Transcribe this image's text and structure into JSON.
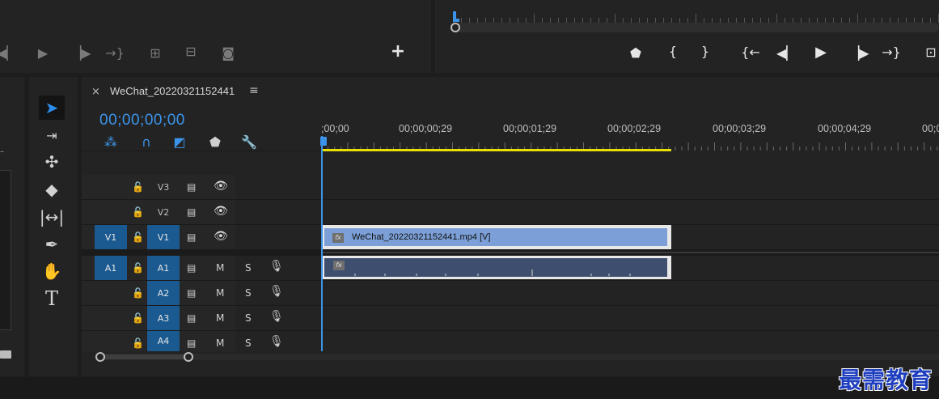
{
  "source_monitor": {
    "transport": [
      "step-back-icon",
      "play-icon",
      "step-forward-icon",
      "go-to-out-icon",
      "insert-icon",
      "overwrite-icon",
      "export-frame-icon",
      "add-button-icon"
    ],
    "plus_label": "+"
  },
  "program_monitor": {
    "transport": [
      "marker-icon",
      "mark-in-icon",
      "mark-out-icon",
      "go-to-in-icon",
      "step-back-icon",
      "play-icon",
      "step-forward-icon",
      "go-to-out-icon",
      "lift-icon"
    ]
  },
  "tools": [
    "selection-tool-icon",
    "track-select-tool-icon",
    "ripple-edit-tool-icon",
    "razor-tool-icon",
    "slip-tool-icon",
    "pen-tool-icon",
    "hand-tool-icon",
    "type-tool-icon"
  ],
  "timeline": {
    "close_label": "×",
    "sequence_name": "WeChat_20220321152441",
    "menu_label": "≡",
    "timecode": "00;00;00;00",
    "header_icons": [
      "nest-icon",
      "snap-icon",
      "linked-selection-icon",
      "add-marker-icon",
      "settings-wrench-icon"
    ],
    "ruler_labels": [
      ";00;00",
      "00;00;00;29",
      "00;00;01;29",
      "00;00;02;29",
      "00;00;03;29",
      "00;00;04;29",
      "00;0"
    ],
    "video_tracks": [
      {
        "name": "V3",
        "source": "",
        "active": false
      },
      {
        "name": "V2",
        "source": "",
        "active": false
      },
      {
        "name": "V1",
        "source": "V1",
        "active": true
      }
    ],
    "audio_tracks": [
      {
        "name": "A1",
        "source": "A1",
        "active": true,
        "m": "M",
        "s": "S"
      },
      {
        "name": "A2",
        "source": "",
        "active": true,
        "m": "M",
        "s": "S"
      },
      {
        "name": "A3",
        "source": "",
        "active": true,
        "m": "M",
        "s": "S"
      },
      {
        "name": "A4",
        "source": "",
        "active": true,
        "m": "M",
        "s": "S"
      }
    ],
    "video_clip": {
      "name": "WeChat_20220321152441.mp4 [V]",
      "fx": "fx"
    },
    "audio_clip": {
      "fx": "fx"
    },
    "colors": {
      "accent": "#3b94ea",
      "track_target": "#1a5a91",
      "work_area": "#e8e000",
      "video_clip": "#7b9fd6",
      "audio_clip": "#3e4e6e"
    }
  },
  "watermark": "最需教育"
}
